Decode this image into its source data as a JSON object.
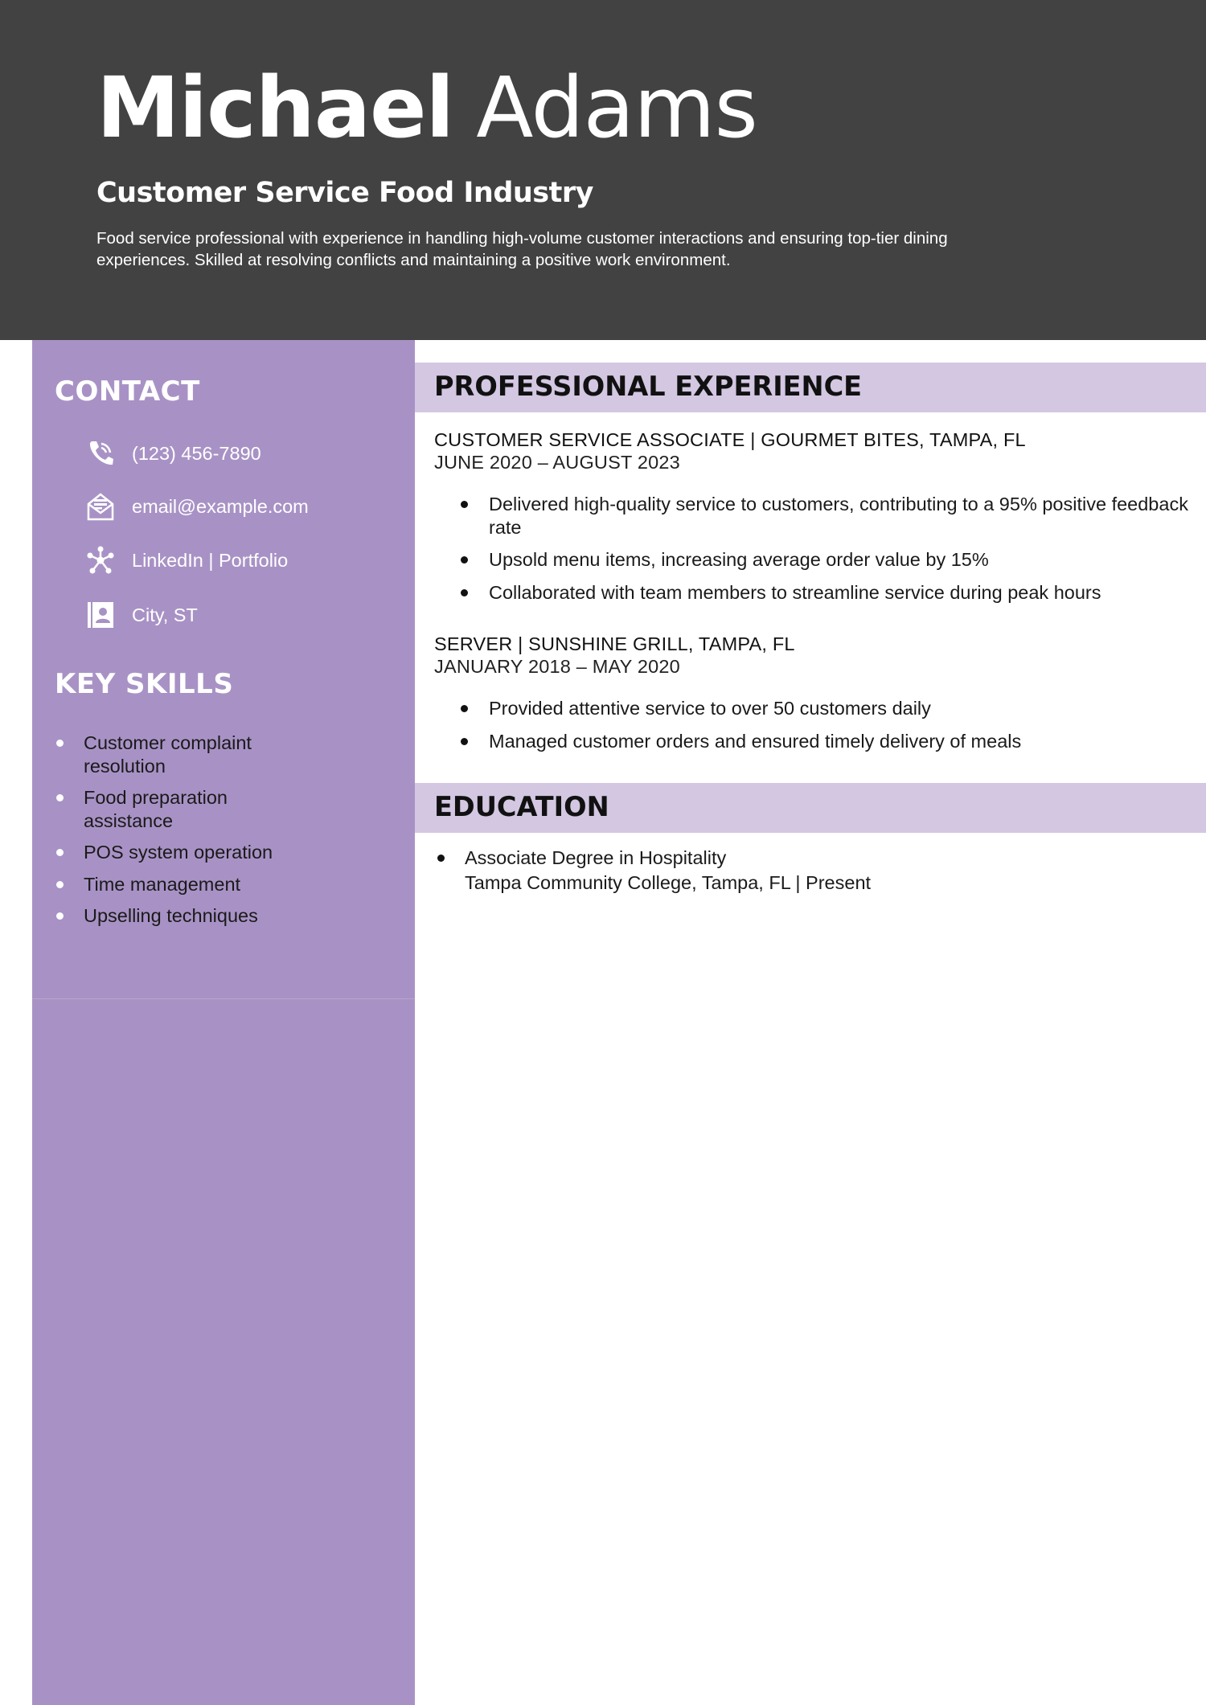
{
  "header": {
    "first_name": "Michael",
    "last_name": "Adams",
    "job_title": "Customer Service Food Industry",
    "summary": "Food service professional with experience in handling high-volume customer interactions and ensuring top-tier dining experiences. Skilled at resolving conflicts and maintaining a positive work environment."
  },
  "sidebar": {
    "contact_heading": "CONTACT",
    "contact": [
      {
        "icon": "phone-icon",
        "text": "(123) 456-7890"
      },
      {
        "icon": "envelope-icon",
        "text": "email@example.com"
      },
      {
        "icon": "network-icon",
        "text": "LinkedIn | Portfolio"
      },
      {
        "icon": "address-book-icon",
        "text": "City, ST"
      }
    ],
    "skills_heading": "KEY SKILLS",
    "skills": [
      "Customer complaint resolution",
      "Food preparation assistance",
      "POS system operation",
      "Time management",
      "Upselling techniques"
    ]
  },
  "experience": {
    "heading": "PROFESSIONAL EXPERIENCE",
    "jobs": [
      {
        "role": "CUSTOMER SERVICE ASSOCIATE | GOURMET BITES, TAMPA, FL",
        "dates": "JUNE 2020 – AUGUST 2023",
        "bullets": [
          "Delivered high-quality service to customers, contributing to a 95% positive feedback rate",
          "Upsold menu items, increasing average order value by 15%",
          "Collaborated with team members to streamline service during peak hours"
        ]
      },
      {
        "role": "SERVER | SUNSHINE GRILL, TAMPA, FL",
        "dates": "JANUARY 2018 – MAY 2020",
        "bullets": [
          "Provided attentive service to over 50 customers daily",
          "Managed customer orders and ensured timely delivery of meals"
        ]
      }
    ]
  },
  "education": {
    "heading": "EDUCATION",
    "items": [
      {
        "degree": "Associate Degree in Hospitality",
        "school": "Tampa Community College, Tampa, FL | Present"
      }
    ]
  },
  "colors": {
    "header_bg": "#424242",
    "sidebar_bg": "#a892c5",
    "section_band": "#d3c7e2"
  }
}
